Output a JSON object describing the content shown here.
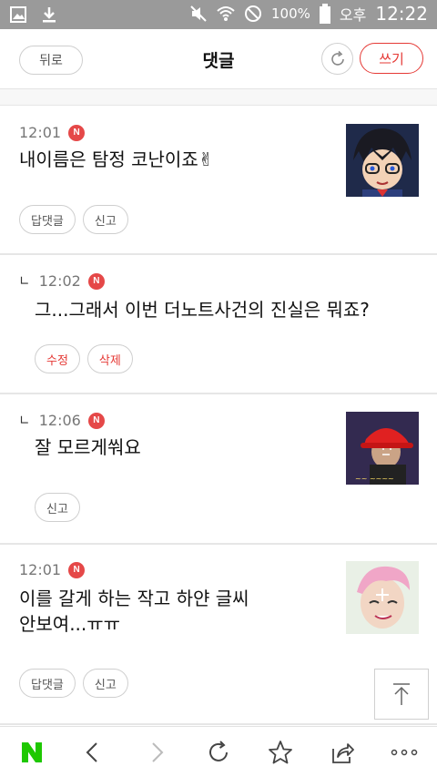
{
  "status_bar": {
    "battery_percent": "100%",
    "ampm": "오후",
    "time": "12:22"
  },
  "header": {
    "back_label": "뒤로",
    "title": "댓글",
    "write_label": "쓰기"
  },
  "comments": [
    {
      "time": "12:01",
      "badge": "N",
      "is_reply": false,
      "text_lines": [
        "내이름은 탐정 코난이죠✌"
      ],
      "buttons": [
        "답댓글",
        "신고"
      ],
      "has_thumb": true
    },
    {
      "time": "12:02",
      "badge": "N",
      "is_reply": true,
      "reply_mark": "∟",
      "text_lines": [
        "그...그래서 이번 더노트사건의 진실은 뭐죠?"
      ],
      "buttons": [
        "수정",
        "삭제"
      ],
      "has_thumb": false
    },
    {
      "time": "12:06",
      "badge": "N",
      "is_reply": true,
      "reply_mark": "∟",
      "text_lines": [
        "잘 모르게쒀요"
      ],
      "buttons": [
        "신고"
      ],
      "has_thumb": true
    },
    {
      "time": "12:01",
      "badge": "N",
      "is_reply": false,
      "text_lines": [
        "이를 갈게 하는 작고 하얀 글씨",
        "안보여...ㅠㅠ"
      ],
      "buttons": [
        "답댓글",
        "신고"
      ],
      "has_thumb": true
    }
  ],
  "bottom_bar": {
    "logo": "N",
    "items": [
      "n-logo-icon",
      "back-arrow-icon",
      "forward-arrow-icon",
      "reload-icon",
      "star-icon",
      "share-icon",
      "more-icon"
    ]
  },
  "colors": {
    "accent_red": "#e53935",
    "badge_red": "#e54848",
    "naver_green": "#1ec800"
  }
}
